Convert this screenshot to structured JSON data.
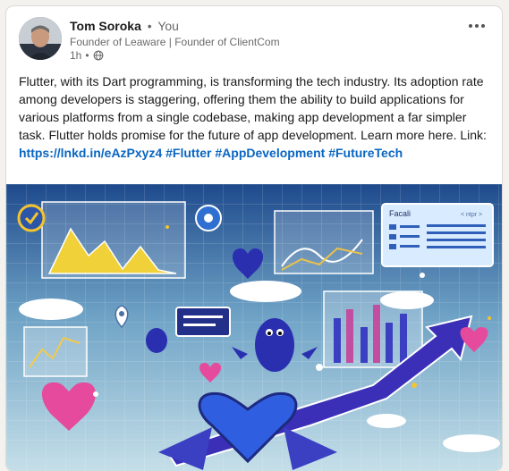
{
  "post": {
    "author": {
      "name": "Tom Soroka",
      "relation": "You",
      "headline": "Founder of Leaware | Founder of ClientCom",
      "time": "1h"
    },
    "body_text": "Flutter, with its Dart programming, is transforming the tech industry. Its adoption rate among developers is staggering, offering them the ability to build applications for various platforms from a single codebase, making app development a far simpler task. Flutter holds promise for the future of app development. Learn more here. Link: ",
    "link": "https://lnkd.in/eAzPxyz4",
    "hashtags": [
      "#Flutter",
      "#AppDevelopment",
      "#FutureTech"
    ],
    "icons": {
      "visibility": "globe-icon",
      "menu": "more-options-icon"
    },
    "image": {
      "panel_text": "Facali",
      "panel_tag": "< ntpr >"
    }
  },
  "colors": {
    "link": "#0a66c2",
    "page_bg": "#f4f2ee"
  }
}
